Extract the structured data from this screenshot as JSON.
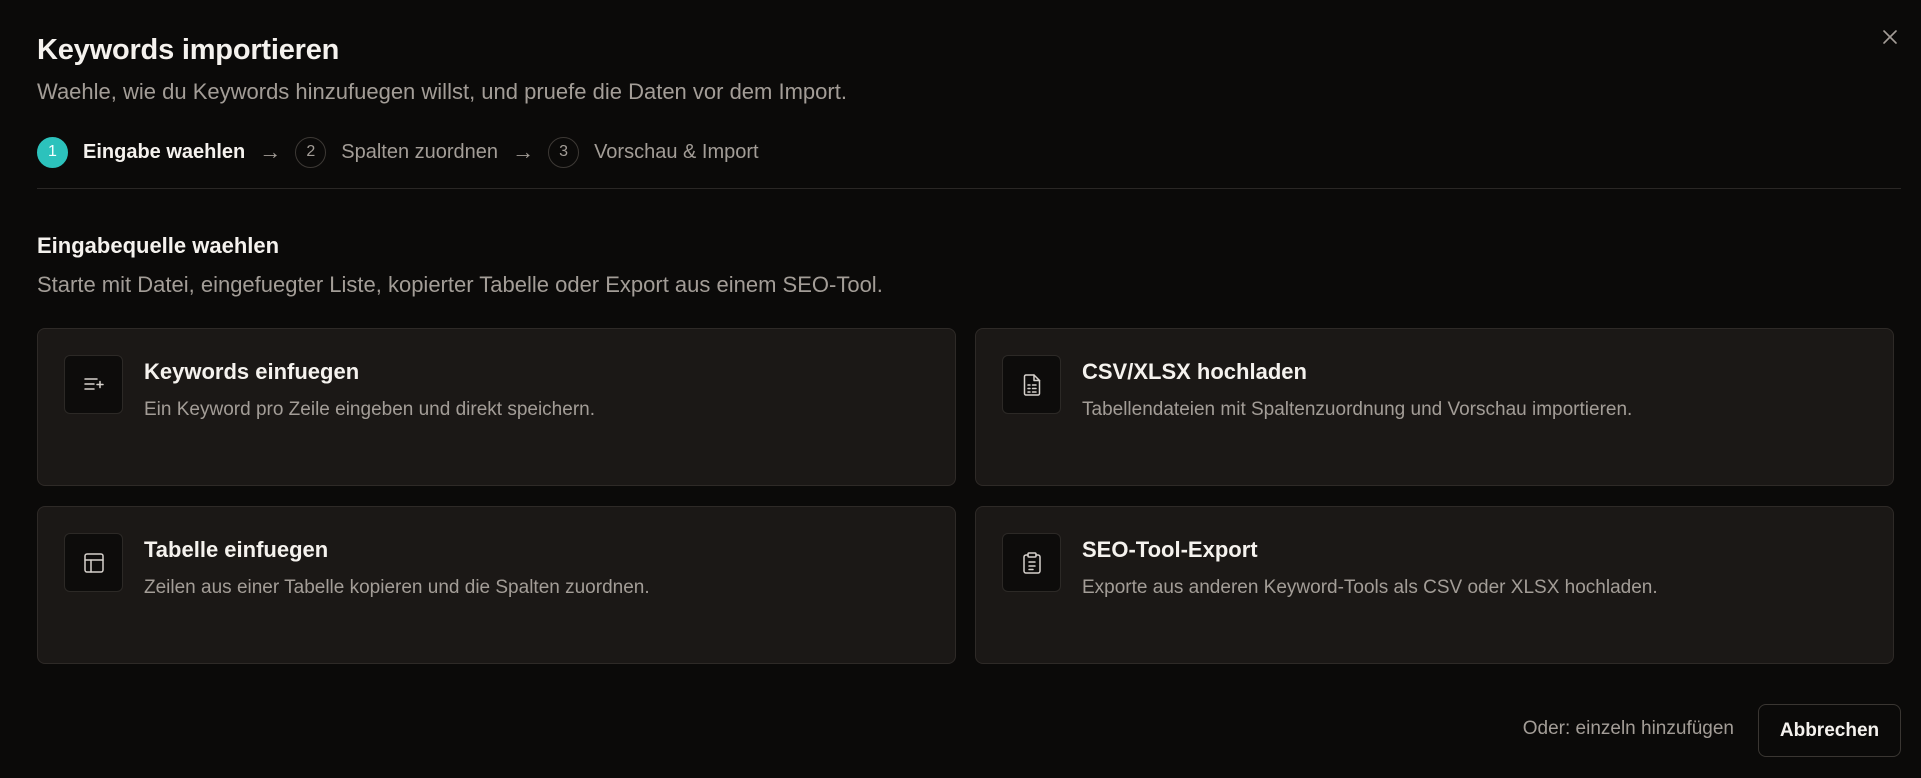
{
  "dialog": {
    "title": "Keywords importieren",
    "subtitle": "Waehle, wie du Keywords hinzufuegen willst, und pruefe die Daten vor dem Import.",
    "close_icon": "close-icon"
  },
  "stepper": {
    "steps": [
      {
        "number": "1",
        "label": "Eingabe waehlen",
        "active": true
      },
      {
        "number": "2",
        "label": "Spalten zuordnen",
        "active": false
      },
      {
        "number": "3",
        "label": "Vorschau & Import",
        "active": false
      }
    ],
    "separator": "→"
  },
  "section": {
    "title": "Eingabequelle waehlen",
    "description": "Starte mit Datei, eingefuegter Liste, kopierter Tabelle oder Export aus einem SEO-Tool."
  },
  "options": [
    {
      "icon": "list-plus-icon",
      "title": "Keywords einfuegen",
      "description": "Ein Keyword pro Zeile eingeben und direkt speichern."
    },
    {
      "icon": "file-spreadsheet-icon",
      "title": "CSV/XLSX hochladen",
      "description": "Tabellendateien mit Spaltenzuordnung und Vorschau importieren."
    },
    {
      "icon": "table-icon",
      "title": "Tabelle einfuegen",
      "description": "Zeilen aus einer Tabelle kopieren und die Spalten zuordnen."
    },
    {
      "icon": "clipboard-list-icon",
      "title": "SEO-Tool-Export",
      "description": "Exporte aus anderen Keyword-Tools als CSV oder XLSX hochladen."
    }
  ],
  "footer": {
    "single_add_link": "Oder: einzeln hinzufügen",
    "cancel_label": "Abbrechen"
  },
  "colors": {
    "background": "#0b0a09",
    "card": "#1b1816",
    "accent": "#2cc2bc",
    "muted_text": "#a39d97"
  }
}
